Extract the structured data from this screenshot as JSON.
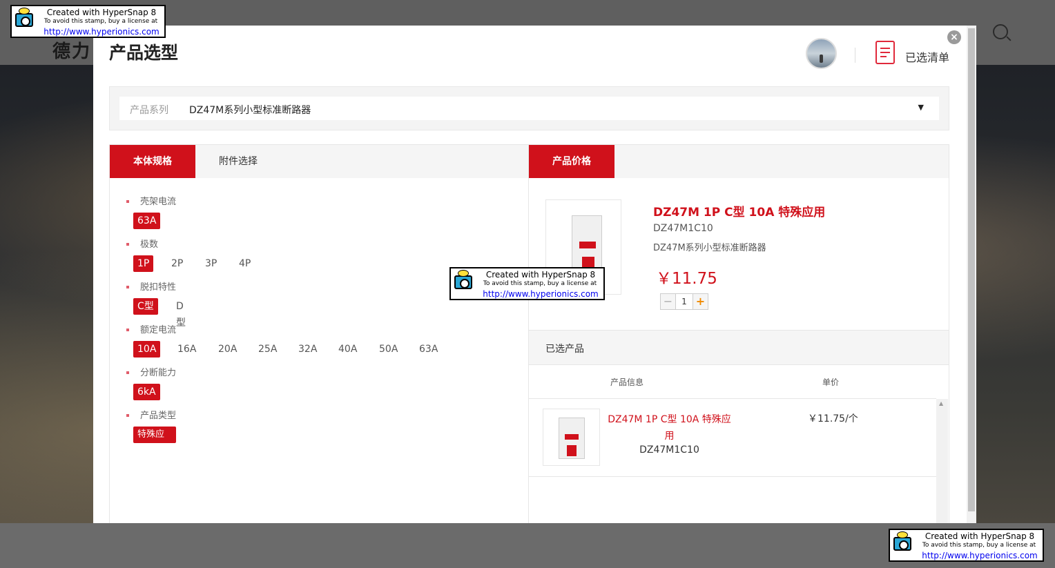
{
  "background": {
    "logo_text": "德力"
  },
  "modal": {
    "title": "产品选型",
    "close_symbol": "×",
    "selected_list_label": "已选清单"
  },
  "series": {
    "label": "产品系列",
    "value": "DZ47M系列小型标准断路器",
    "caret": "▼"
  },
  "left_tabs": [
    {
      "label": "本体规格",
      "active": true
    },
    {
      "label": "附件选择",
      "active": false
    }
  ],
  "specs": [
    {
      "title": "壳架电流",
      "options": [
        "63A"
      ],
      "selected": "63A"
    },
    {
      "title": "极数",
      "options": [
        "1P",
        "2P",
        "3P",
        "4P"
      ],
      "selected": "1P"
    },
    {
      "title": "脱扣特性",
      "options": [
        "C型",
        "D型"
      ],
      "selected": "C型"
    },
    {
      "title": "额定电流",
      "options": [
        "10A",
        "16A",
        "20A",
        "25A",
        "32A",
        "40A",
        "50A",
        "63A"
      ],
      "selected": "10A"
    },
    {
      "title": "分断能力",
      "options": [
        "6kA"
      ],
      "selected": "6kA"
    },
    {
      "title": "产品类型",
      "options": [
        "特殊应用"
      ],
      "selected": "特殊应用"
    }
  ],
  "right_tab": {
    "label": "产品价格"
  },
  "product": {
    "name": "DZ47M 1P C型 10A 特殊应用",
    "code": "DZ47M1C10",
    "series": "DZ47M系列小型标准断路器",
    "price": "￥11.75",
    "quantity": "1",
    "minus": "−",
    "plus": "+"
  },
  "selected": {
    "heading": "已选产品",
    "columns": [
      "产品信息",
      "单价"
    ],
    "rows": [
      {
        "name": "DZ47M 1P C型 10A 特殊应用",
        "code": "DZ47M1C10",
        "price": "￥11.75/个"
      }
    ]
  },
  "stamp": {
    "line1": "Created with HyperSnap 8",
    "line2": "To avoid this stamp, buy a license at",
    "line3": "http://www.hyperionics.com"
  },
  "colors": {
    "accent": "#d0111b",
    "icon_red": "#e0283a"
  }
}
